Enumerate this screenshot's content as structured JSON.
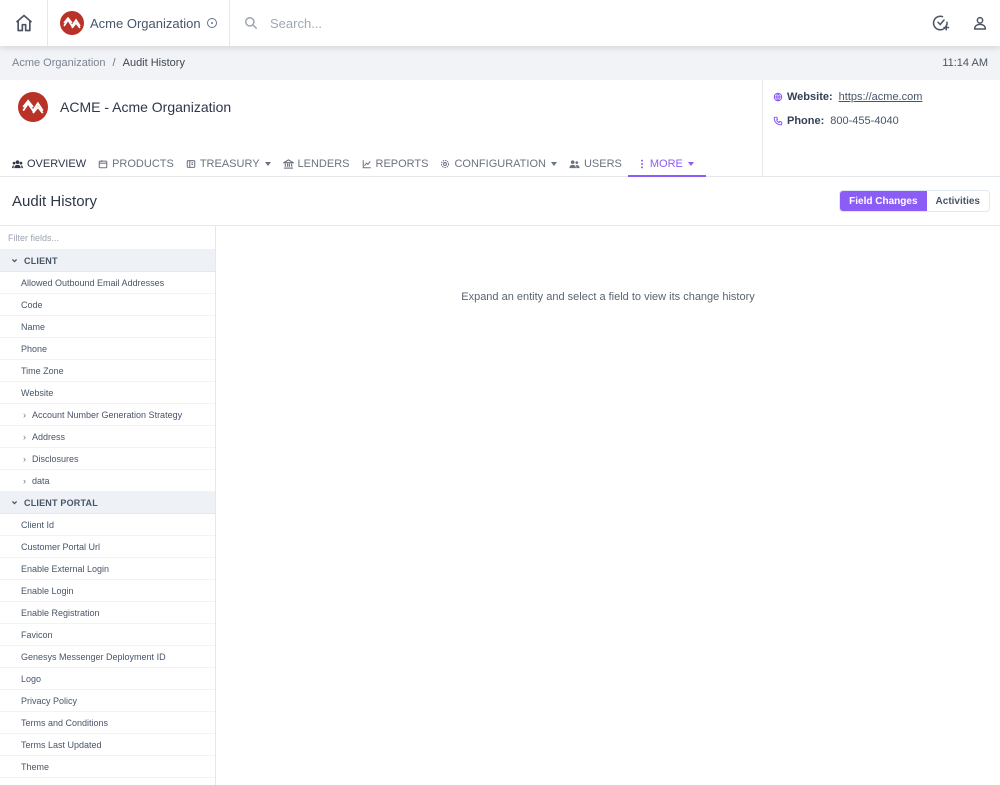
{
  "topbar": {
    "org_name": "Acme Organization",
    "search_placeholder": "Search..."
  },
  "breadcrumb": {
    "parent": "Acme Organization",
    "separator": "/",
    "current": "Audit History",
    "time": "11:14 AM"
  },
  "entity": {
    "title": "ACME - Acme Organization",
    "website_label": "Website:",
    "website_value": "https://acme.com",
    "phone_label": "Phone:",
    "phone_value": "800-455-4040"
  },
  "tabs": [
    {
      "label": "OVERVIEW",
      "icon": "users-icon"
    },
    {
      "label": "PRODUCTS",
      "icon": "box-icon"
    },
    {
      "label": "TREASURY",
      "icon": "wallet-icon",
      "dropdown": true
    },
    {
      "label": "LENDERS",
      "icon": "bank-icon"
    },
    {
      "label": "REPORTS",
      "icon": "chart-icon"
    },
    {
      "label": "CONFIGURATION",
      "icon": "gear-icon",
      "dropdown": true
    },
    {
      "label": "USERS",
      "icon": "users-icon"
    },
    {
      "label": "MORE",
      "icon": "more-vertical-icon",
      "dropdown": true,
      "active": true
    }
  ],
  "audit": {
    "title": "Audit History",
    "toggle_field_changes": "Field Changes",
    "toggle_activities": "Activities",
    "filter_placeholder": "Filter fields...",
    "empty_message": "Expand an entity and select a field to view its change history"
  },
  "groups": [
    {
      "name": "CLIENT",
      "fields": [
        "Allowed Outbound Email Addresses",
        "Code",
        "Name",
        "Phone",
        "Time Zone",
        "Website"
      ],
      "subgroups": [
        "Account Number Generation Strategy",
        "Address",
        "Disclosures",
        "data"
      ]
    },
    {
      "name": "CLIENT PORTAL",
      "fields": [
        "Client Id",
        "Customer Portal Url",
        "Enable External Login",
        "Enable Login",
        "Enable Registration",
        "Favicon",
        "Genesys Messenger Deployment ID",
        "Logo",
        "Privacy Policy",
        "Terms and Conditions",
        "Terms Last Updated",
        "Theme"
      ],
      "subgroups": []
    }
  ],
  "colors": {
    "accent": "#8b5cf6",
    "brand": "#b83227"
  }
}
